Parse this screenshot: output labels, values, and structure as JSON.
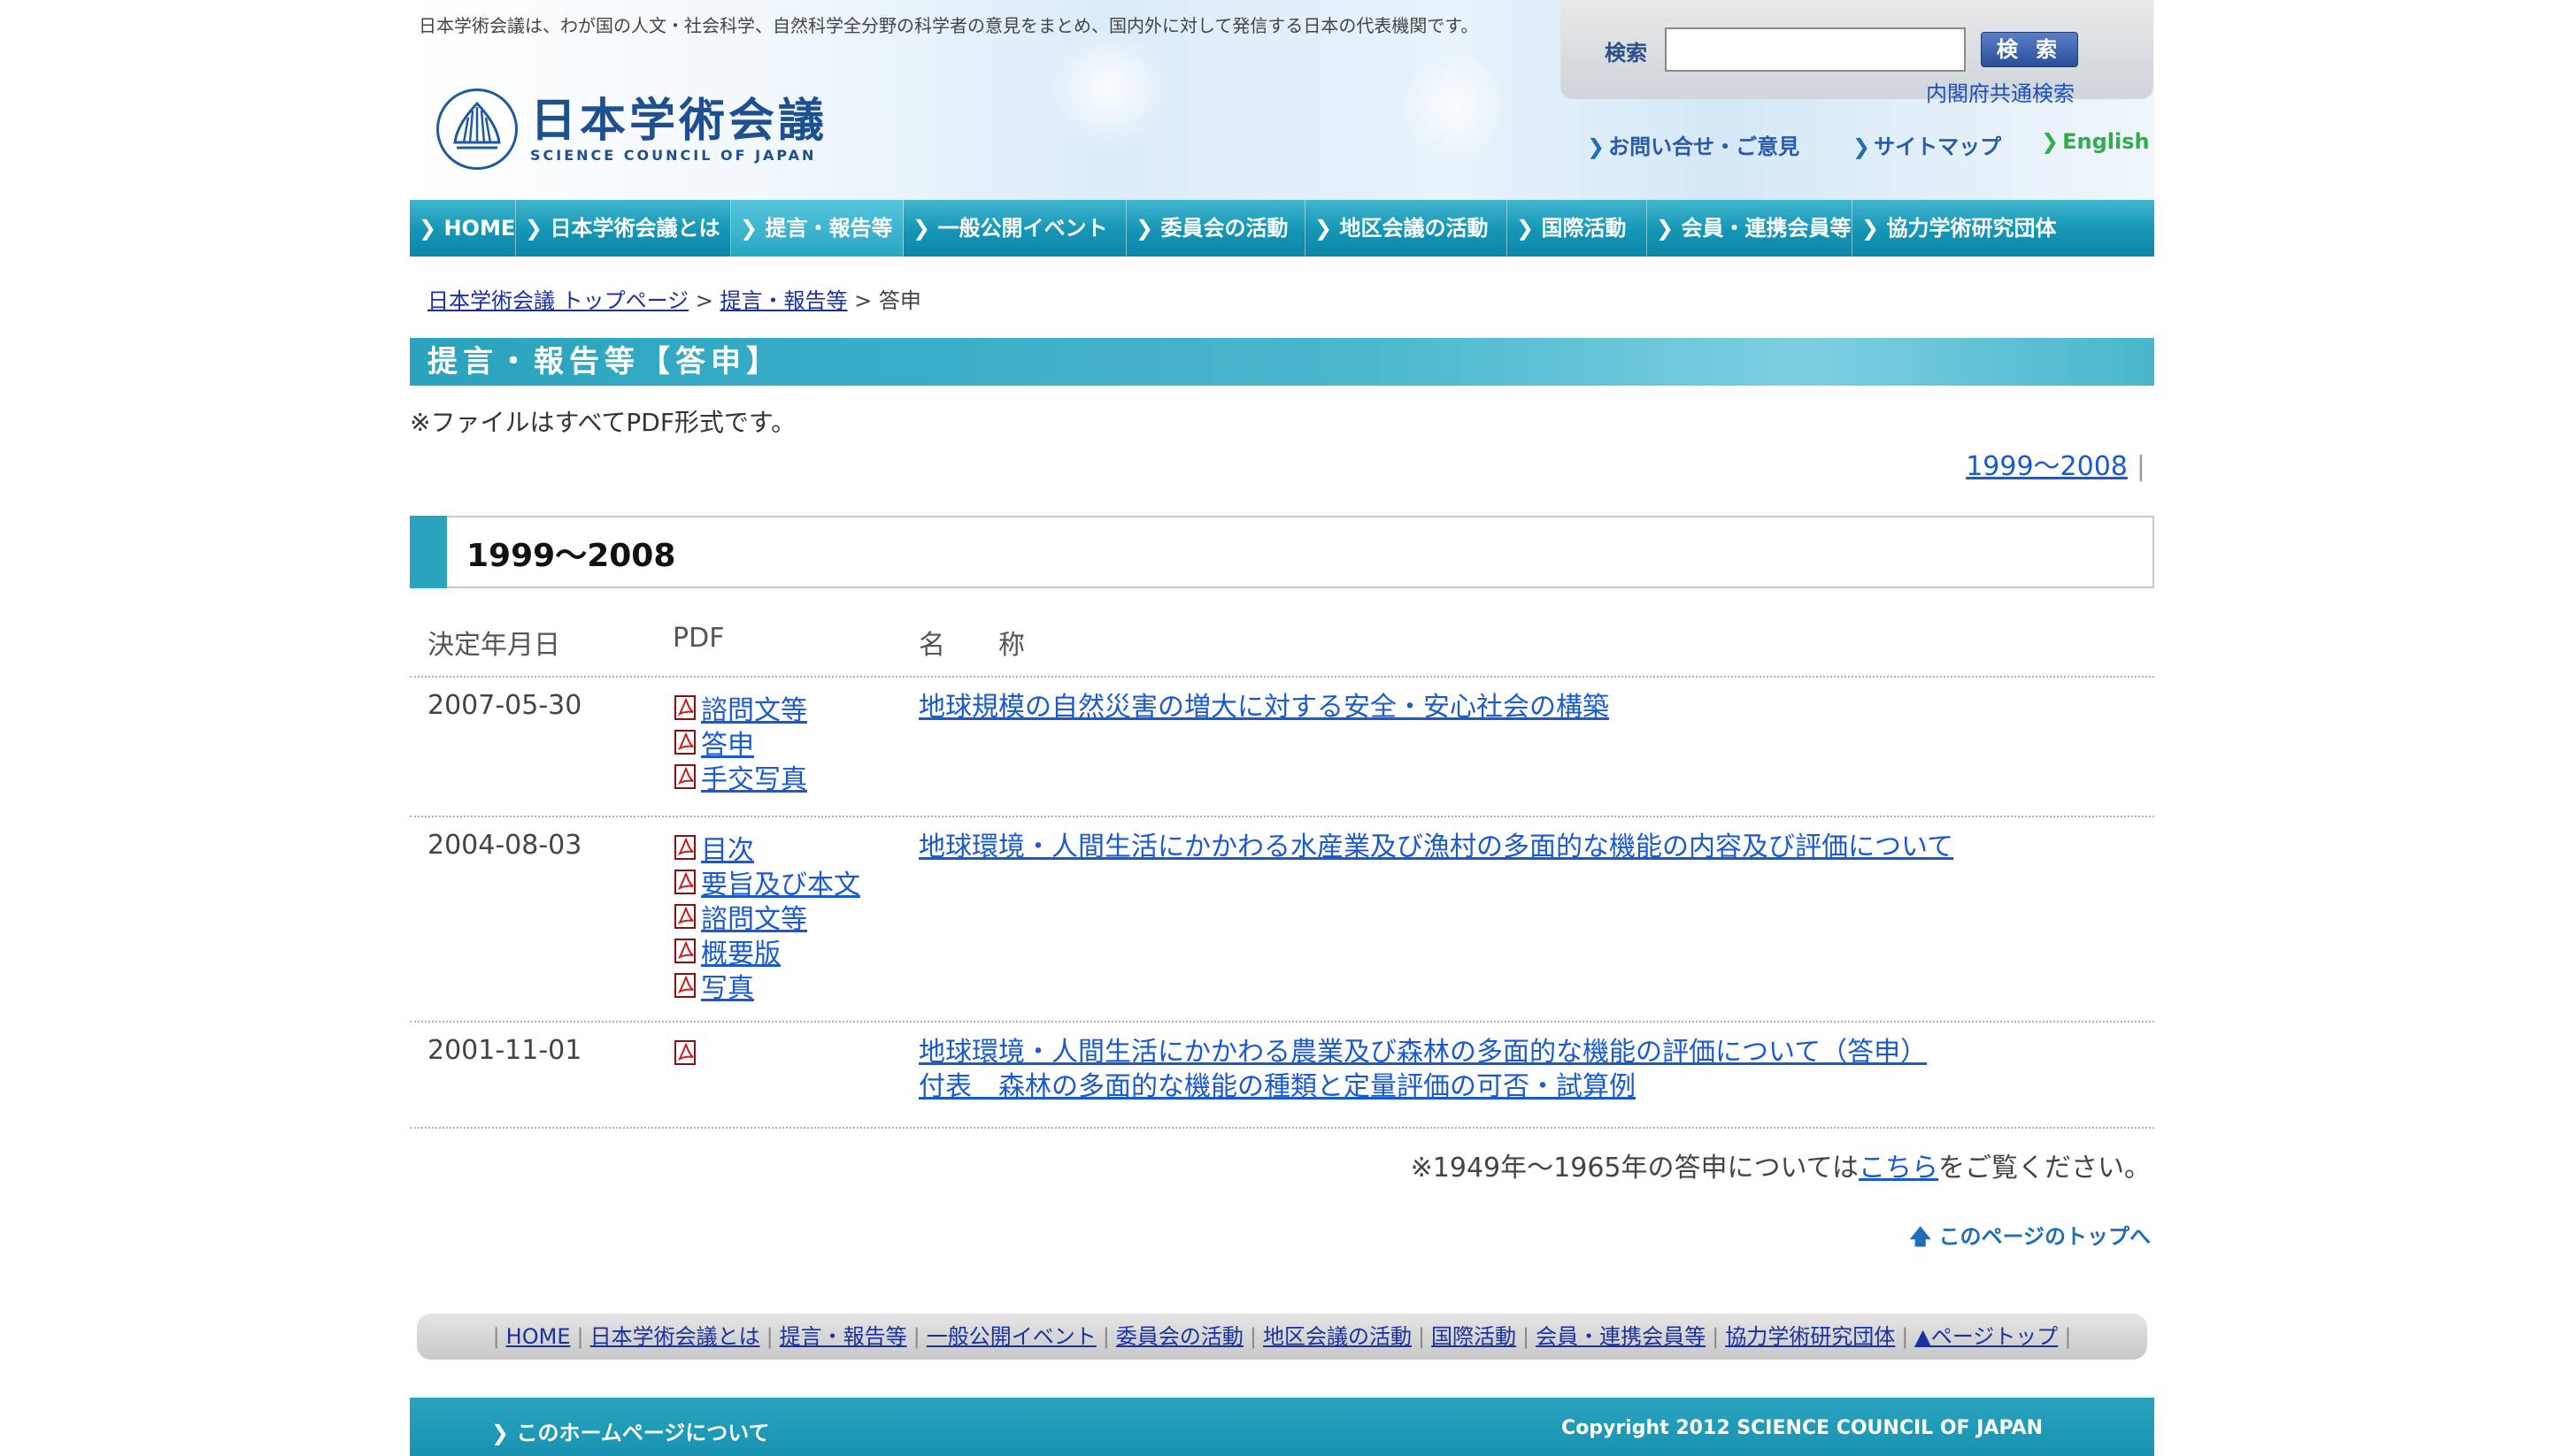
{
  "header": {
    "tagline": "日本学術会議は、わが国の人文・社会科学、自然科学全分野の科学者の意見をまとめ、国内外に対して発信する日本の代表機関です。",
    "logo_jp": "日本学術会議",
    "logo_en": "SCIENCE COUNCIL OF JAPAN",
    "search_label": "検索",
    "search_value": "",
    "search_button": "検 索",
    "search_common": "内閣府共通検索",
    "links": [
      "お問い合せ・ご意見",
      "サイトマップ",
      "English"
    ]
  },
  "nav": {
    "items": [
      "HOME",
      "日本学術会議とは",
      "提言・報告等",
      "一般公開イベント",
      "委員会の活動",
      "地区会議の活動",
      "国際活動",
      "会員・連携会員等",
      "協力学術研究団体"
    ],
    "active": "提言・報告等"
  },
  "breadcrumb": {
    "home": "日本学術会議 トップページ",
    "sep1": " > ",
    "section": "提言・報告等",
    "sep2": " > ",
    "current": "答申"
  },
  "page": {
    "title": "提言・報告等【答申】",
    "note": "※ファイルはすべてPDF形式です。",
    "year_link": "1999〜2008",
    "section_title": "1999〜2008"
  },
  "table": {
    "headers": [
      "決定年月日",
      "PDF",
      "名　　称"
    ],
    "rows": [
      {
        "date": "2007-05-30",
        "pdfs": [
          "諮問文等",
          "答申",
          "手交写真"
        ],
        "names": [
          "地球規模の自然災害の増大に対する安全・安心社会の構築"
        ]
      },
      {
        "date": "2004-08-03",
        "pdfs": [
          "目次",
          "要旨及び本文",
          "諮問文等",
          "概要版",
          "写真"
        ],
        "names": [
          "地球環境・人間生活にかかわる水産業及び漁村の多面的な機能の内容及び評価について"
        ]
      },
      {
        "date": "2001-11-01",
        "pdfs": [
          ""
        ],
        "names": [
          "地球環境・人間生活にかかわる農業及び森林の多面的な機能の評価について（答申）",
          "付表　森林の多面的な機能の種類と定量評価の可否・試算例"
        ]
      }
    ]
  },
  "footnote": {
    "before": "※1949年〜1965年の答申については",
    "link": "こちら",
    "after": "をご覧ください。"
  },
  "pagetop": "このページのトップへ",
  "footer_nav": [
    "HOME",
    "日本学術会議とは",
    "提言・報告等",
    "一般公開イベント",
    "委員会の活動",
    "地区会議の活動",
    "国際活動",
    "会員・連携会員等",
    "協力学術研究団体",
    "▲ページトップ"
  ],
  "footer": {
    "about": "このホームページについて",
    "copyright": "Copyright 2012 SCIENCE COUNCIL OF JAPAN"
  },
  "colors": {
    "nav_teal": "#1595b5",
    "link_blue": "#1a5ad0",
    "pdf_red": "#c81e1e",
    "english_green": "#2fae4a"
  }
}
